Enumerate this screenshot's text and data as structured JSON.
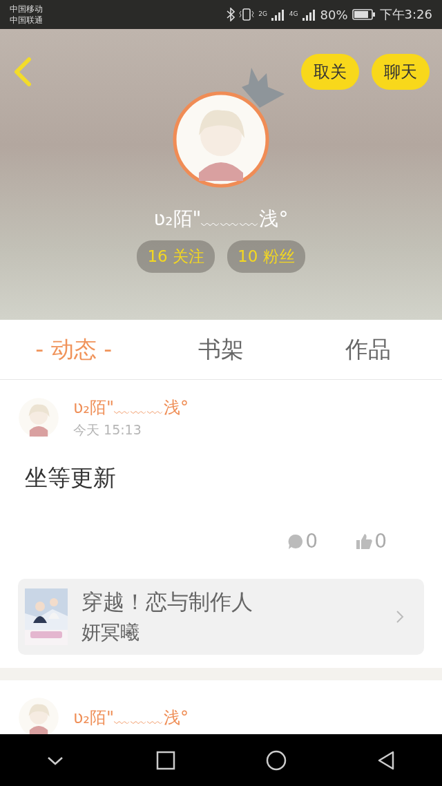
{
  "status_bar": {
    "carriers": [
      "中国移动",
      "中国联通"
    ],
    "network_1": "2G",
    "network_2": "4G",
    "battery": "80%",
    "time": "下午3:26"
  },
  "header": {
    "actions": [
      {
        "label": "取关"
      },
      {
        "label": "聊天"
      }
    ],
    "username": "ʋ₂陌\"﹏﹏﹏浅°",
    "stats": [
      {
        "label": "16 关注"
      },
      {
        "label": "10 粉丝"
      }
    ]
  },
  "tabs": [
    {
      "label": "- 动态 -",
      "selected": true
    },
    {
      "label": "书架",
      "selected": false
    },
    {
      "label": "作品",
      "selected": false
    }
  ],
  "posts": [
    {
      "author": "ʋ₂陌\"﹏﹏﹏浅°",
      "time": "今天 15:13",
      "content": "坐等更新",
      "comments": "0",
      "likes": "0",
      "book": {
        "title": "穿越！恋与制作人",
        "author": "妍冥曦"
      }
    },
    {
      "author": "ʋ₂陌\"﹏﹏﹏浅°"
    }
  ]
}
